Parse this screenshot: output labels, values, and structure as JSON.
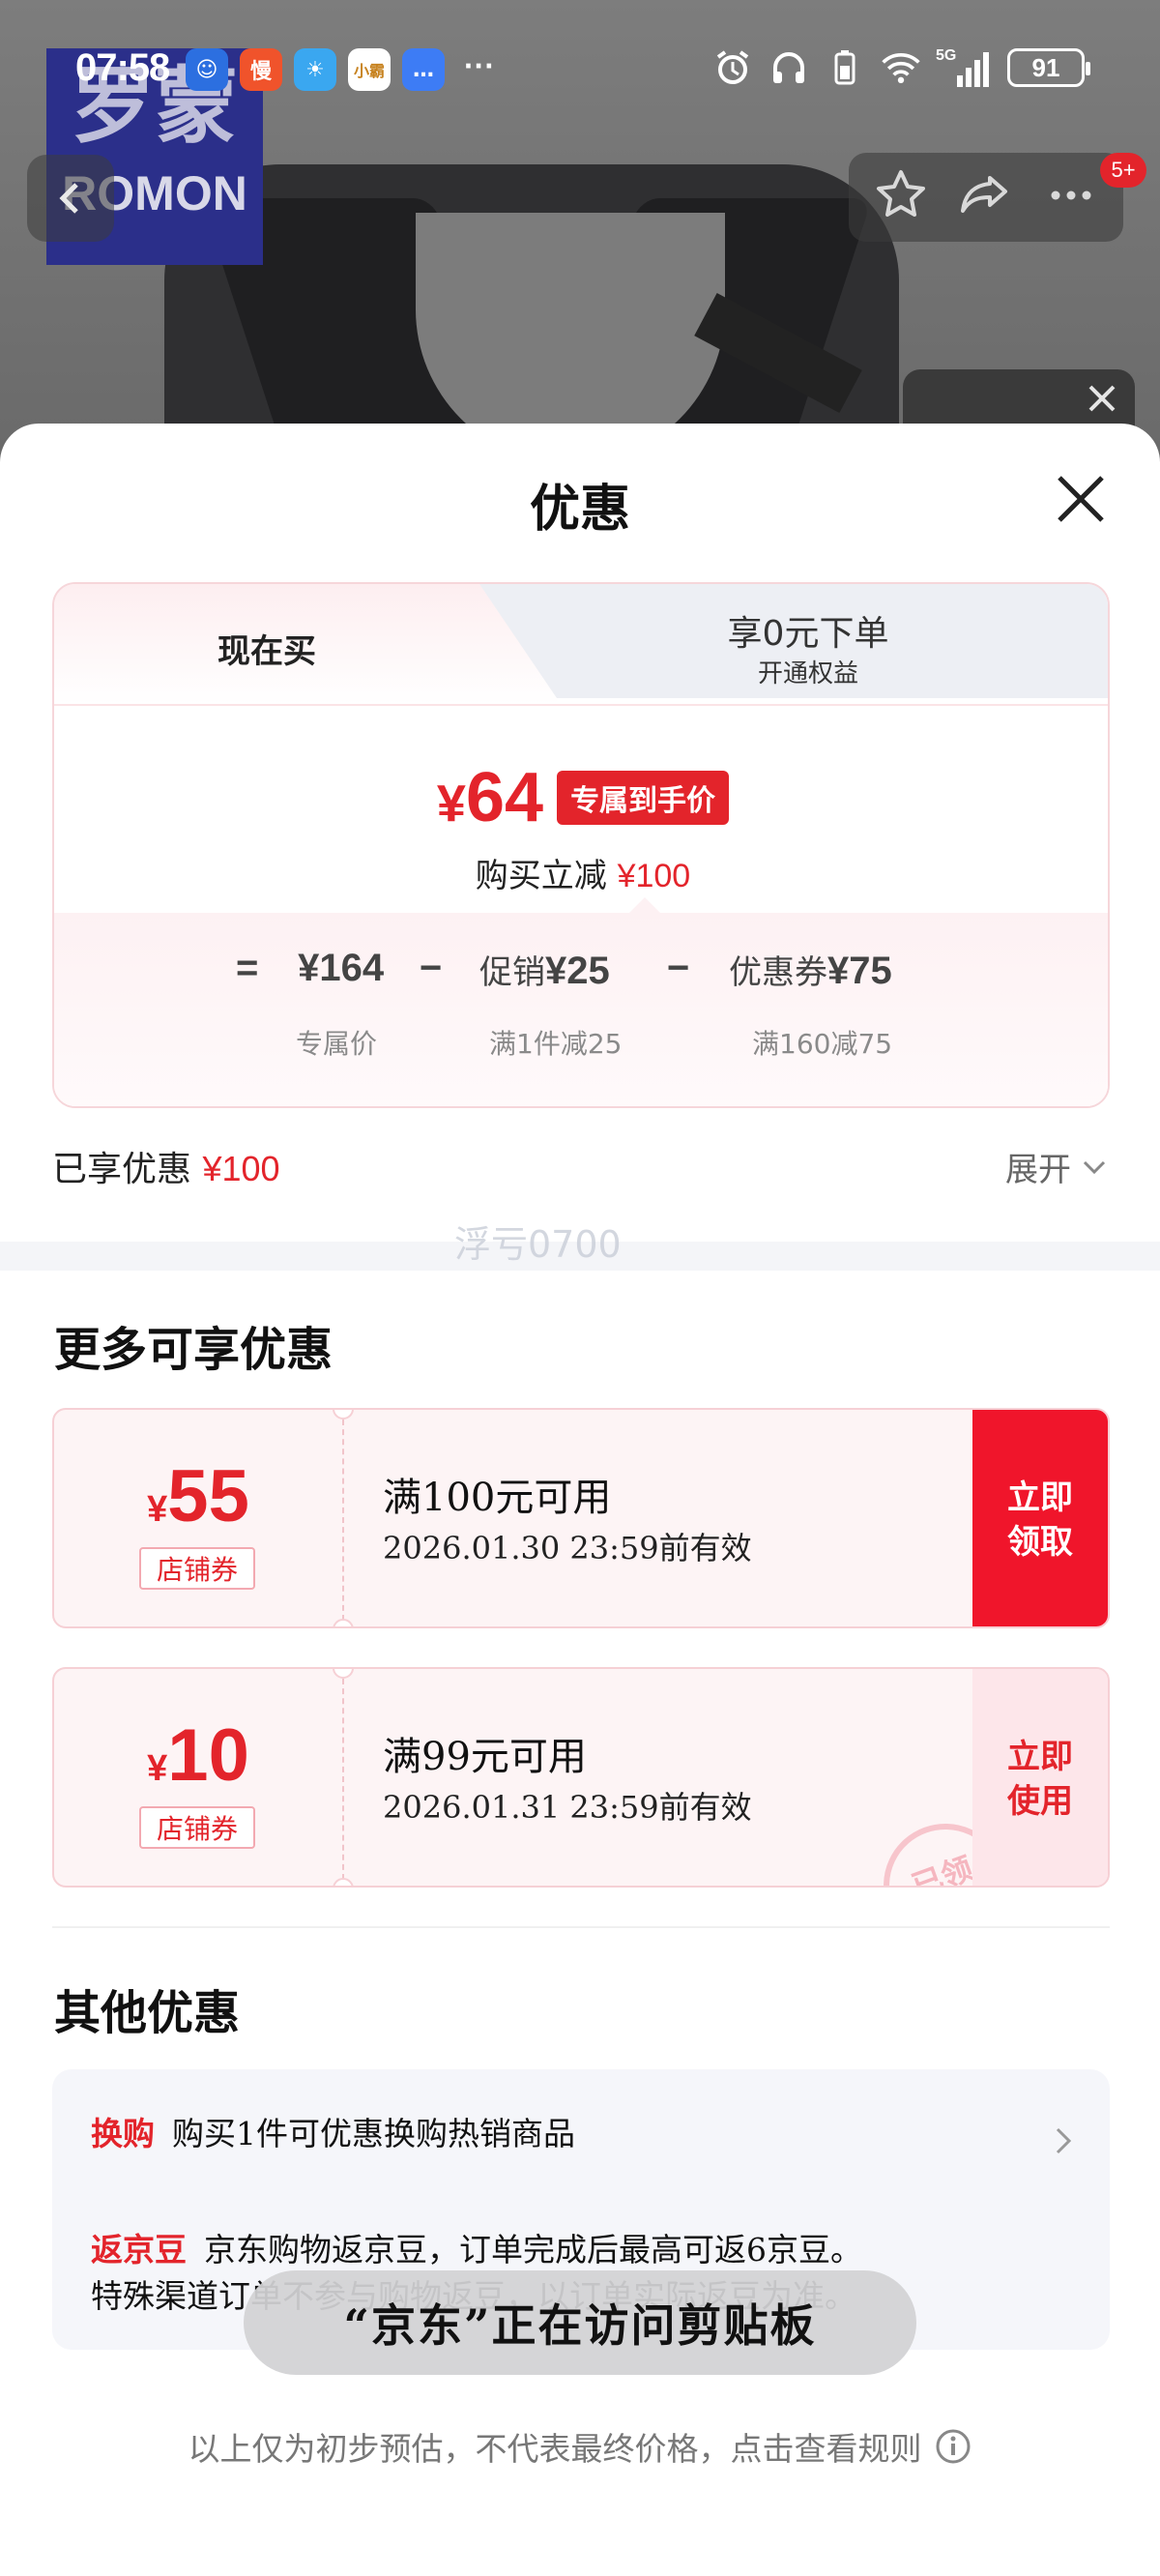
{
  "status_bar": {
    "time": "07:58",
    "network": "5G",
    "battery": "91",
    "apps": [
      {
        "icon": "hello-app-icon",
        "color": "#2c6fe0",
        "label": ""
      },
      {
        "icon": "man-app-icon",
        "color": "#f0532b",
        "label": "慢"
      },
      {
        "icon": "weather-app-icon",
        "color": "#3aa7f0",
        "label": ""
      },
      {
        "icon": "xiaoyu-app-icon",
        "color": "#ffffff",
        "label": "小霸"
      },
      {
        "icon": "message-app-icon",
        "color": "#3d7cf5",
        "label": ""
      }
    ]
  },
  "product_header": {
    "brand_cn": "罗蒙",
    "brand_en": "ROMON",
    "cart_badge": "5+"
  },
  "sheet": {
    "title": "优惠",
    "tabs": {
      "buy_now": "现在买",
      "zero_order_title": "享0元下单",
      "zero_order_sub": "开通权益"
    },
    "final_price_symbol": "¥",
    "final_price": "64",
    "exclusive_tag": "专属到手价",
    "reduce_text": "购买立减",
    "reduce_amount": "¥100",
    "breakdown": {
      "eq": "=",
      "base_price": "¥164",
      "base_label": "专属价",
      "minus1": "−",
      "promo_label_top": "促销",
      "promo_value": "¥25",
      "promo_sub": "满1件减25",
      "minus2": "−",
      "coupon_label_top": "优惠券",
      "coupon_value": "¥75",
      "coupon_sub": "满160减75"
    },
    "enjoyed_text": "已享优惠",
    "enjoyed_amount": "¥100",
    "expand_label": "展开",
    "watermark": "浮亏0700"
  },
  "more_discounts": {
    "heading": "更多可享优惠",
    "coupons": [
      {
        "symbol": "¥",
        "amount": "55",
        "tag": "店铺券",
        "condition": "满100元可用",
        "expiry": "2026.01.30 23:59前有效",
        "action_line1": "立即",
        "action_line2": "领取"
      },
      {
        "symbol": "¥",
        "amount": "10",
        "tag": "店铺券",
        "condition": "满99元可用",
        "expiry": "2026.01.31 23:59前有效",
        "action_line1": "立即",
        "action_line2": "使用",
        "stamp": "已领"
      }
    ]
  },
  "other_discounts": {
    "heading": "其他优惠",
    "trade_in_tag": "换购",
    "trade_in_text": "购买1件可优惠换购热销商品",
    "jingdou_tag": "返京豆",
    "jingdou_text_1": "京东购物返京豆，订单完成后最高可返6京豆。",
    "jingdou_text_2": "特殊渠道订单不参与购物返豆，以订单实际返豆为准。"
  },
  "toast": "“京东”正在访问剪贴板",
  "footer_note": "以上仅为初步预估，不代表最终价格，点击查看规则"
}
